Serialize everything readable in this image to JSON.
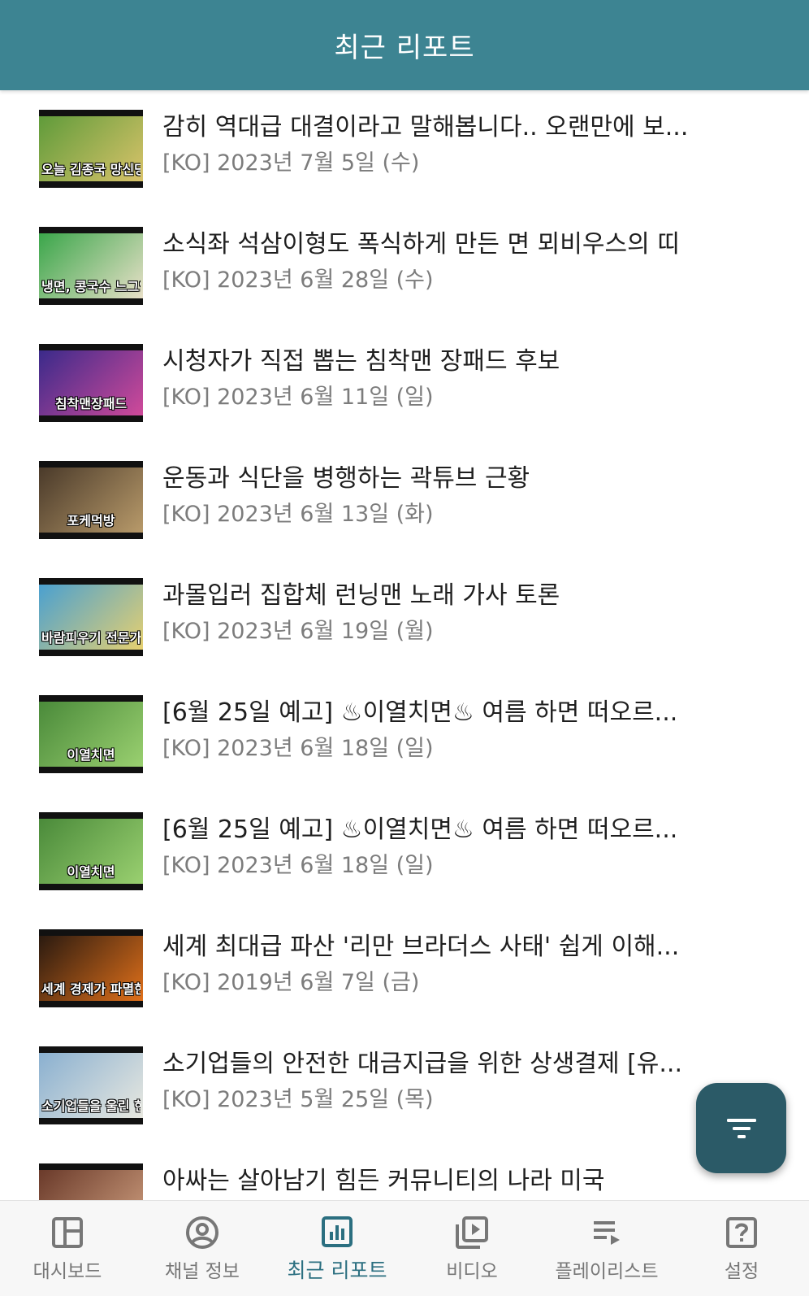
{
  "header": {
    "title": "최근 리포트"
  },
  "reports": [
    {
      "title": "감히 역대급 대결이라고 말해봅니다.. 오랜만에 보...",
      "date": "[KO] 2023년 7월 5일 (수)",
      "thumb_caption": "오늘 김종국 망신당하는 날?",
      "thumb_colors": [
        "#5f9b3a",
        "#d9c36a"
      ]
    },
    {
      "title": "소식좌 석삼이형도 폭식하게 만든 면 뫼비우스의 띠",
      "date": "[KO] 2023년 6월 28일 (수)",
      "thumb_caption": "냉면, 콩국수 느그양 죽여줘",
      "thumb_colors": [
        "#3aa64a",
        "#e8e0c8"
      ]
    },
    {
      "title": "시청자가 직접 뽑는 침착맨 장패드 후보",
      "date": "[KO] 2023년 6월 11일 (일)",
      "thumb_caption": "침착맨장패드",
      "thumb_colors": [
        "#3a2a8a",
        "#d04a9a"
      ]
    },
    {
      "title": "운동과 식단을 병행하는 곽튜브 근황",
      "date": "[KO] 2023년 6월 13일 (화)",
      "thumb_caption": "포케먹방",
      "thumb_colors": [
        "#4a3a2a",
        "#b89a6a"
      ]
    },
    {
      "title": "과몰입러 집합체 런닝맨 노래 가사 토론",
      "date": "[KO] 2023년 6월 19일 (월)",
      "thumb_caption": "바람피우기 전문가 김종국?",
      "thumb_colors": [
        "#4aa0d0",
        "#e6d070"
      ]
    },
    {
      "title": "[6월 25일 예고] ♨이열치면♨ 여름 하면 떠오르...",
      "date": "[KO] 2023년 6월 18일 (일)",
      "thumb_caption": "이열치면",
      "thumb_colors": [
        "#4a8a3a",
        "#9ad070"
      ]
    },
    {
      "title": "[6월 25일 예고] ♨이열치면♨ 여름 하면 떠오르...",
      "date": "[KO] 2023년 6월 18일 (일)",
      "thumb_caption": "이열치면",
      "thumb_colors": [
        "#4a8a3a",
        "#9ad070"
      ]
    },
    {
      "title": "세계 최대급 파산 '리만 브라더스 사태' 쉽게 이해...",
      "date": "[KO] 2019년 6월 7일 (금)",
      "thumb_caption": "세계 경제가 파멸한 '리만 사태'",
      "thumb_colors": [
        "#2a1a10",
        "#e0701a"
      ]
    },
    {
      "title": "소기업들의 안전한 대금지급을 위한 상생결제 [유...",
      "date": "[KO] 2023년 5월 25일 (목)",
      "thumb_caption": "소기업들을 울린 한 장의 종이",
      "thumb_colors": [
        "#8ab0d0",
        "#e8e8e0"
      ]
    },
    {
      "title": "아싸는 살아남기 힘든 커뮤니티의 나라 미국",
      "date": "",
      "thumb_caption": "",
      "thumb_colors": [
        "#6a3a2a",
        "#d0a080"
      ]
    }
  ],
  "fab": {
    "icon": "filter-icon"
  },
  "bottom_nav": [
    {
      "label": "대시보드",
      "icon": "dashboard-icon",
      "active": false
    },
    {
      "label": "채널 정보",
      "icon": "account-circle-icon",
      "active": false
    },
    {
      "label": "최근 리포트",
      "icon": "bar-chart-icon",
      "active": true
    },
    {
      "label": "비디오",
      "icon": "video-library-icon",
      "active": false
    },
    {
      "label": "플레이리스트",
      "icon": "playlist-icon",
      "active": false
    },
    {
      "label": "설정",
      "icon": "help-box-icon",
      "active": false
    }
  ],
  "colors": {
    "header": "#3d8492",
    "fab": "#2b5a67",
    "nav_active": "#2b6f80",
    "nav_inactive": "#777777"
  }
}
